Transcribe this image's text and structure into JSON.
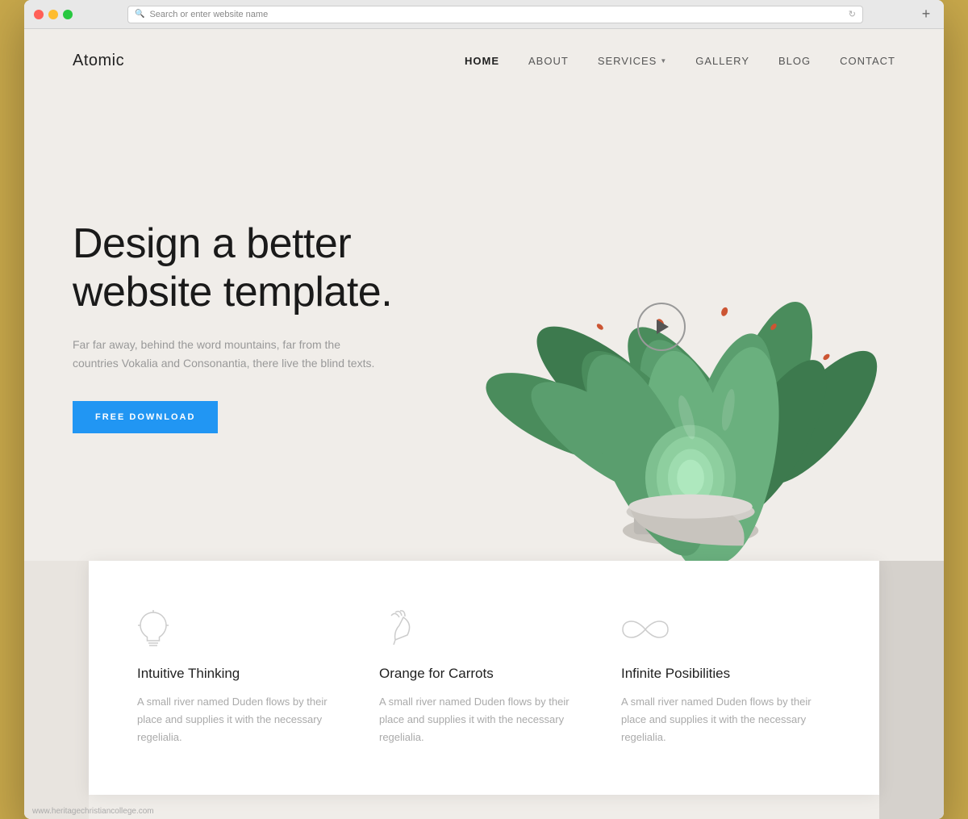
{
  "browser": {
    "address_placeholder": "Search or enter website name",
    "add_tab_icon": "+"
  },
  "nav": {
    "logo": "Atomic",
    "links": [
      {
        "label": "HOME",
        "active": true
      },
      {
        "label": "ABOUT",
        "active": false
      },
      {
        "label": "SERVICES",
        "active": false,
        "dropdown": true
      },
      {
        "label": "GALLERY",
        "active": false
      },
      {
        "label": "BLOG",
        "active": false
      },
      {
        "label": "CONTACT",
        "active": false
      }
    ]
  },
  "hero": {
    "title": "Design a better website template.",
    "subtitle": "Far far away, behind the word mountains, far from the countries Vokalia and Consonantia, there live the blind texts.",
    "cta_label": "FREE DOWNLOAD",
    "play_button_label": "Play video"
  },
  "features": [
    {
      "icon": "bulb",
      "title": "Intuitive Thinking",
      "description": "A small river named Duden flows by their place and supplies it with the necessary regelialia."
    },
    {
      "icon": "carrot",
      "title": "Orange for Carrots",
      "description": "A small river named Duden flows by their place and supplies it with the necessary regelialia."
    },
    {
      "icon": "infinity",
      "title": "Infinite Posibilities",
      "description": "A small river named Duden flows by their place and supplies it with the necessary regelialia."
    }
  ],
  "watermark": {
    "text": "www.heritagechristiancollege.com"
  },
  "colors": {
    "accent": "#2196F3",
    "text_dark": "#1a1a1a",
    "text_muted": "#999999",
    "bg_hero": "#f0ede9",
    "bg_white": "#ffffff"
  }
}
